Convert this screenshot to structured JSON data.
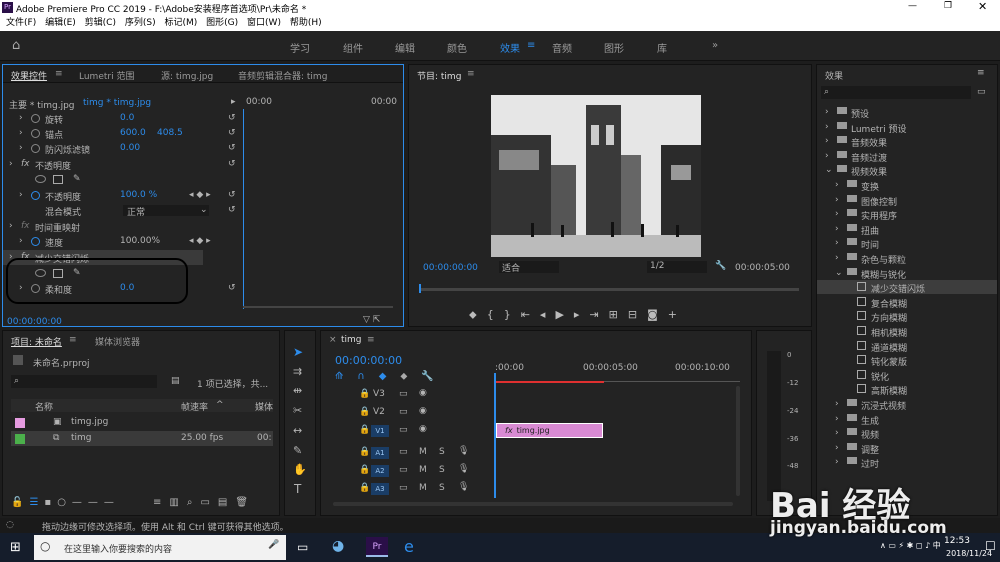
{
  "window": {
    "title": "Adobe Premiere Pro CC 2019 - F:\\Adobe安装程序首选项\\Pr\\未命名 *",
    "app_icon": "Pr"
  },
  "menu": [
    "文件(F)",
    "编辑(E)",
    "剪辑(C)",
    "序列(S)",
    "标记(M)",
    "图形(G)",
    "窗口(W)",
    "帮助(H)"
  ],
  "workspaces": [
    "学习",
    "组件",
    "编辑",
    "颜色",
    "效果",
    "音频",
    "图形",
    "库"
  ],
  "effect_controls": {
    "tabs": [
      "效果控件",
      "Lumetri 范围",
      "源: timg.jpg",
      "音频剪辑混合器: timg"
    ],
    "master": "主要 * timg.jpg",
    "seq": "timg * timg.jpg",
    "tc_left": "00:00",
    "tc_right": "00:00",
    "rows": [
      {
        "label": "旋转",
        "value": "0.0"
      },
      {
        "label": "锚点",
        "value": "600.0",
        "value2": "408.5"
      },
      {
        "label": "防闪烁滤镜",
        "value": "0.00"
      },
      {
        "label": "不透明度",
        "fx": true
      },
      {
        "label": "不透明度",
        "value": "100.0 %"
      },
      {
        "label": "混合模式",
        "value": "正常"
      },
      {
        "label": "时间重映射",
        "fx": true
      },
      {
        "label": "速度",
        "value": "100.00%"
      },
      {
        "label": "减少交错闪烁",
        "fx": true
      },
      {
        "label": "柔和度",
        "value": "0.0"
      }
    ],
    "timecode": "00:00:00:00"
  },
  "program": {
    "title": "节目: timg",
    "tc": "00:00:00:00",
    "fit": "适合",
    "quality": "1/2",
    "duration": "00:00:05:00"
  },
  "effects": {
    "title": "效果",
    "items": [
      {
        "label": "预设",
        "level": 0,
        "type": "folder"
      },
      {
        "label": "Lumetri 预设",
        "level": 0,
        "type": "folder"
      },
      {
        "label": "音频效果",
        "level": 0,
        "type": "folder"
      },
      {
        "label": "音频过渡",
        "level": 0,
        "type": "folder"
      },
      {
        "label": "视频效果",
        "level": 0,
        "type": "folder",
        "open": true
      },
      {
        "label": "变换",
        "level": 1,
        "type": "folder"
      },
      {
        "label": "图像控制",
        "level": 1,
        "type": "folder"
      },
      {
        "label": "实用程序",
        "level": 1,
        "type": "folder"
      },
      {
        "label": "扭曲",
        "level": 1,
        "type": "folder"
      },
      {
        "label": "时间",
        "level": 1,
        "type": "folder"
      },
      {
        "label": "杂色与颗粒",
        "level": 1,
        "type": "folder"
      },
      {
        "label": "模糊与锐化",
        "level": 1,
        "type": "folder",
        "open": true
      },
      {
        "label": "减少交错闪烁",
        "level": 2,
        "type": "fx",
        "selected": true
      },
      {
        "label": "复合模糊",
        "level": 2,
        "type": "fx"
      },
      {
        "label": "方向模糊",
        "level": 2,
        "type": "fx"
      },
      {
        "label": "相机模糊",
        "level": 2,
        "type": "fx"
      },
      {
        "label": "通道模糊",
        "level": 2,
        "type": "fx"
      },
      {
        "label": "钝化蒙版",
        "level": 2,
        "type": "fx"
      },
      {
        "label": "锐化",
        "level": 2,
        "type": "fx"
      },
      {
        "label": "高斯模糊",
        "level": 2,
        "type": "fx"
      },
      {
        "label": "沉浸式视频",
        "level": 1,
        "type": "folder"
      },
      {
        "label": "生成",
        "level": 1,
        "type": "folder"
      },
      {
        "label": "视频",
        "level": 1,
        "type": "folder"
      },
      {
        "label": "调整",
        "level": 1,
        "type": "folder"
      },
      {
        "label": "过时",
        "level": 1,
        "type": "folder"
      }
    ]
  },
  "project": {
    "tabs": [
      "项目: 未命名",
      "媒体浏览器"
    ],
    "file": "未命名.prproj",
    "status": "1 项已选择，共...",
    "col_name": "名称",
    "col_rate": "帧速率",
    "col_more": "媒体",
    "items": [
      {
        "name": "timg.jpg",
        "rate": "",
        "color": "#e59be0"
      },
      {
        "name": "timg",
        "rate": "25.00 fps",
        "color": "#4bb04b",
        "more": "00:"
      }
    ]
  },
  "timeline": {
    "tab": "timg",
    "tc": "00:00:00:00",
    "ruler": [
      ":00:00",
      "00:00:05:00",
      "00:00:10:00"
    ],
    "video_tracks": [
      "V3",
      "V2",
      "V1"
    ],
    "audio_tracks": [
      "A1",
      "A2",
      "A3"
    ],
    "clip": "timg.jpg"
  },
  "meters": [
    "0",
    "-12",
    "-24",
    "-36",
    "-48"
  ],
  "status_text": "拖动边缘可修改选择项。使用 Alt 和 Ctrl 键可获得其他选项。",
  "taskbar": {
    "search": "在这里输入你要搜索的内容",
    "time": "12:53",
    "date": "2018/11/24"
  },
  "watermark": {
    "brand": "Bai 经验",
    "url": "jingyan.baidu.com"
  }
}
